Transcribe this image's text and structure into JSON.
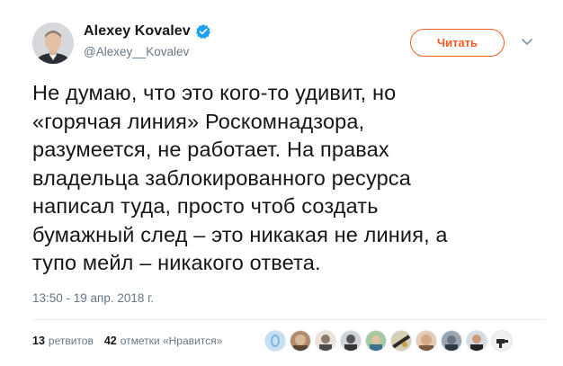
{
  "tweet": {
    "author_name": "Alexey Kovalev",
    "author_handle": "@Alexey__Kovalev",
    "follow_label": "Читать",
    "text": "Не думаю, что это кого-то удивит, но\n«горячая линия» Роскомнадзора,\nразумеется, не работает. На правах\nвладельца заблокированного ресурса\nнаписал туда, просто чтоб создать\nбумажный след – это никакая не линия, а\nтупо мейл – никакого ответа.",
    "timestamp": "13:50 - 19 апр. 2018 г.",
    "retweets_count": "13",
    "retweets_label": "ретвитов",
    "likes_count": "42",
    "likes_label": "отметки «Нравится»"
  },
  "colors": {
    "accent": "#f45d22",
    "verified": "#1da1f2",
    "muted": "#657786",
    "text": "#14171a"
  },
  "icons": [
    "verified-badge-icon",
    "chevron-down-icon"
  ]
}
